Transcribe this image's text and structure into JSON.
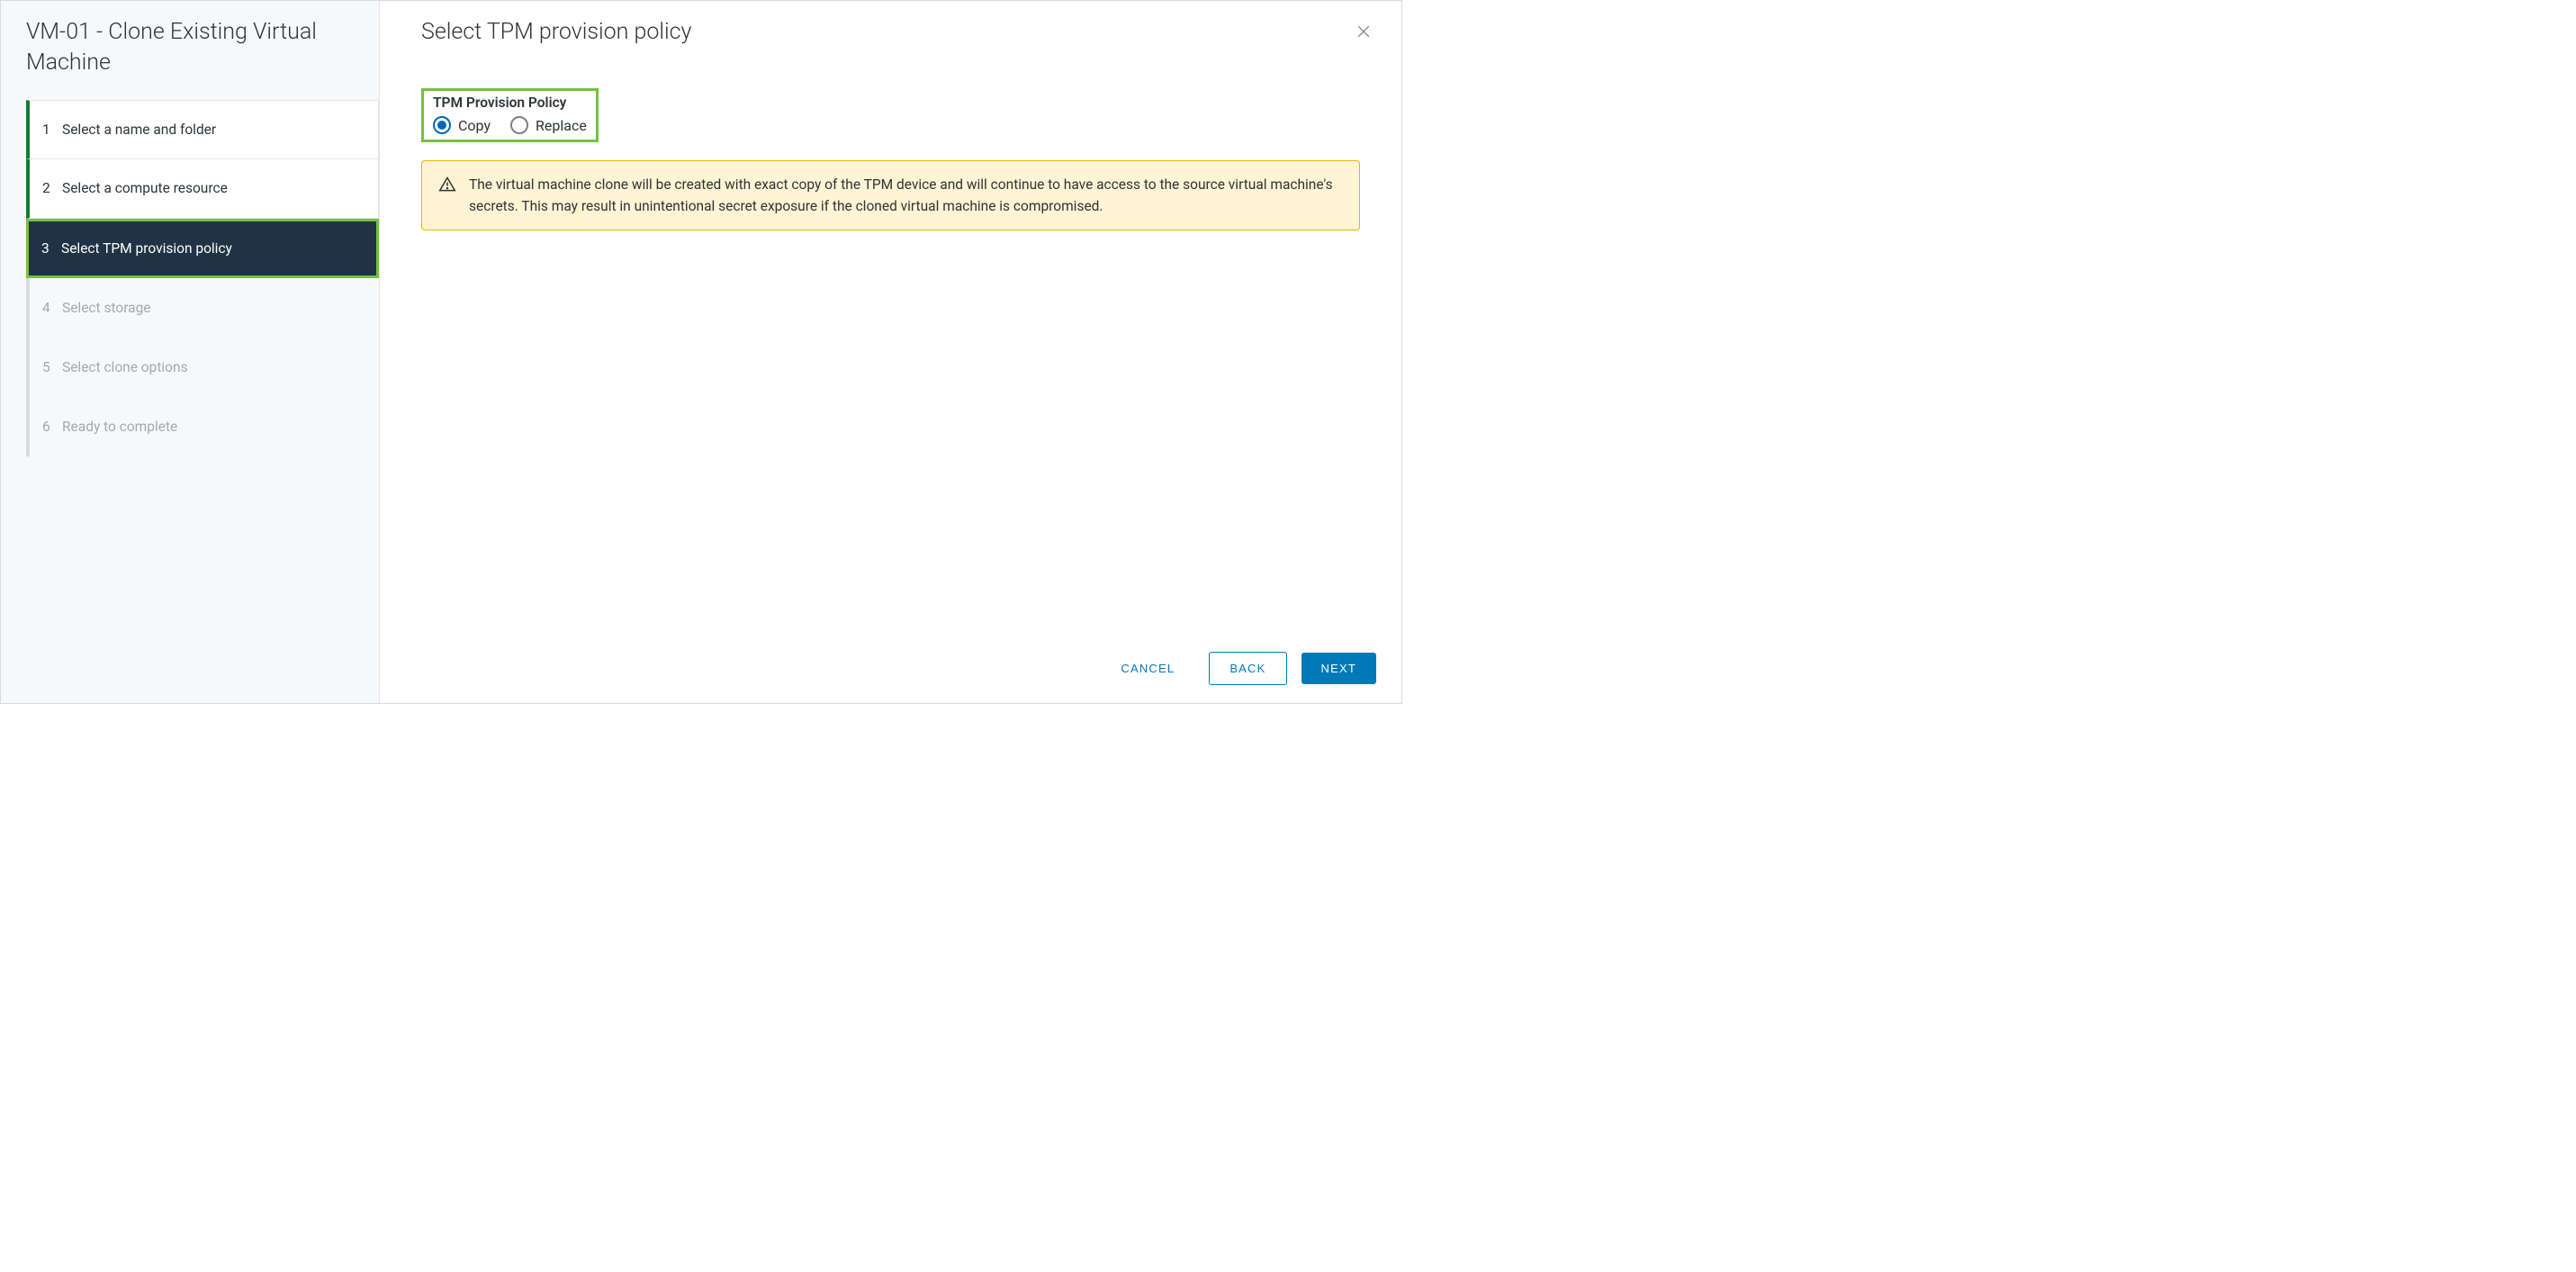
{
  "sidebar": {
    "title": "VM-01 - Clone Existing Virtual Machine",
    "steps": [
      {
        "num": "1",
        "label": "Select a name and folder",
        "state": "completed"
      },
      {
        "num": "2",
        "label": "Select a compute resource",
        "state": "completed"
      },
      {
        "num": "3",
        "label": "Select TPM provision policy",
        "state": "active"
      },
      {
        "num": "4",
        "label": "Select storage",
        "state": "upcoming"
      },
      {
        "num": "5",
        "label": "Select clone options",
        "state": "upcoming"
      },
      {
        "num": "6",
        "label": "Ready to complete",
        "state": "upcoming"
      }
    ]
  },
  "main": {
    "title": "Select TPM provision policy",
    "policy_label": "TPM Provision Policy",
    "options": {
      "copy": "Copy",
      "replace": "Replace"
    },
    "selected": "copy",
    "alert": "The virtual machine clone will be created with exact copy of the TPM device and will continue to have access to the source virtual machine's secrets. This may result in unintentional secret exposure if the cloned virtual machine is compromised."
  },
  "footer": {
    "cancel": "CANCEL",
    "back": "BACK",
    "next": "NEXT"
  }
}
